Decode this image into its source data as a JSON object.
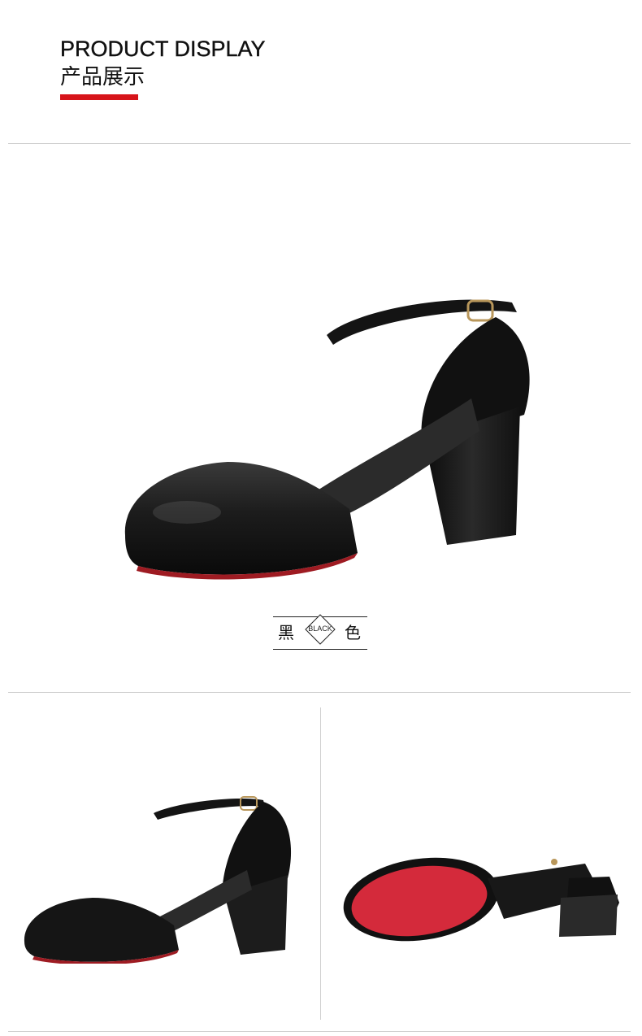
{
  "header": {
    "title_en": "PRODUCT DISPLAY",
    "title_cn": "产品展示",
    "accent_color": "#d7141a"
  },
  "color_label": {
    "left_char": "黑",
    "badge": "BLACK",
    "right_char": "色"
  },
  "images": {
    "main": "black-leather-mary-jane-pump-side-view",
    "detail_left": "black-pump-side-view-small",
    "detail_right": "black-pump-red-sole-bottom-view"
  }
}
